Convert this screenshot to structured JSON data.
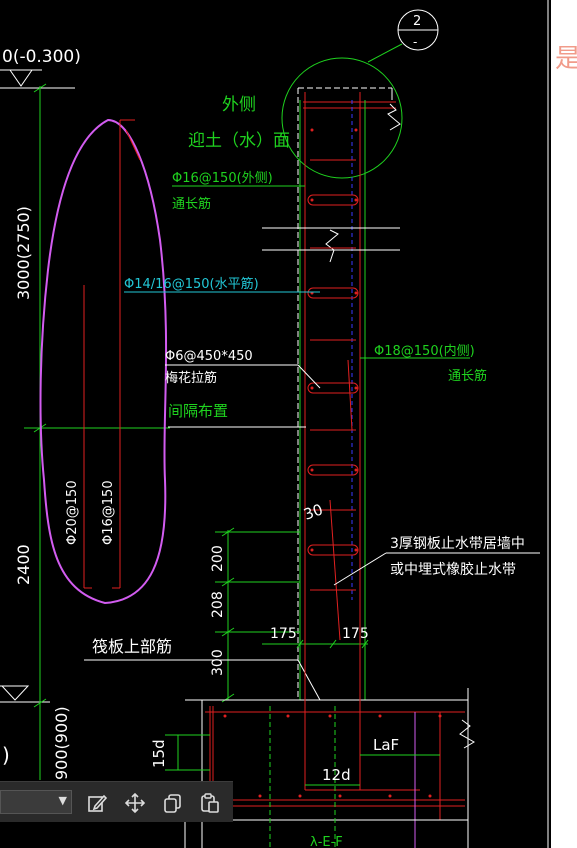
{
  "drawing": {
    "elevation_top": "0(-0.300)",
    "elevation_bottom": ")",
    "detail_ref": {
      "number": "2",
      "sheet": "-"
    },
    "outer_side": "外侧",
    "soil_face": "迎土（水）面",
    "rebar_outer": "Φ16@150(外侧)",
    "rebar_outer_note": "通长筋",
    "rebar_horizontal": "Φ14/16@150(水平筋)",
    "rebar_inner": "Φ18@150(内侧)",
    "rebar_inner_note": "通长筋",
    "tie_bar": "Φ6@450*450",
    "tie_bar_name": "梅花拉筋",
    "tie_bar_note": "间隔布置",
    "bar_a": "Φ20@150",
    "bar_b": "Φ16@150",
    "dim_height_1": "3000(2750)",
    "dim_height_2": "2400",
    "dim_height_3": "900(900)",
    "dim_200": "200",
    "dim_208": "208",
    "dim_300": "300",
    "dim_175_left": "175",
    "dim_175_right": "175",
    "dim_30": "30",
    "waterstop_line1": "3厚钢板止水带居墙中",
    "waterstop_line2": "或中埋式橡胶止水带",
    "raft_rebar": "筏板上部筋",
    "dim_15d": "15d",
    "dim_laf": "LaF",
    "dim_12d": "12d",
    "dim_bottom": "λ-E-F"
  },
  "colors": {
    "green": "#1fd21f",
    "white": "#ffffff",
    "red": "#e02020",
    "cyan": "#22c7d6",
    "magenta": "#d25cf0",
    "yellow": "#e6e600",
    "blue": "#3a3aff"
  },
  "toolbar": {
    "select_value": "",
    "icons": [
      "edit-icon",
      "move-icon",
      "copy-icon",
      "paste-icon"
    ]
  },
  "side_panel": {
    "glyph": "是"
  }
}
